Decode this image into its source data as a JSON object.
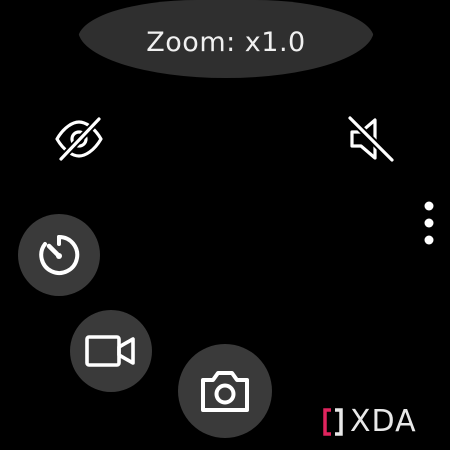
{
  "header": {
    "zoom_label": "Zoom: x1.0"
  },
  "top_controls": {
    "left_icon": "eye-off-icon",
    "right_icon": "volume-off-icon",
    "menu_icon": "more-vertical-icon"
  },
  "bottom_controls": {
    "timer_icon": "timer-icon",
    "video_icon": "video-camera-icon",
    "photo_icon": "camera-icon"
  },
  "watermark": {
    "text": "XDA",
    "accent_color": "#e0245e"
  }
}
